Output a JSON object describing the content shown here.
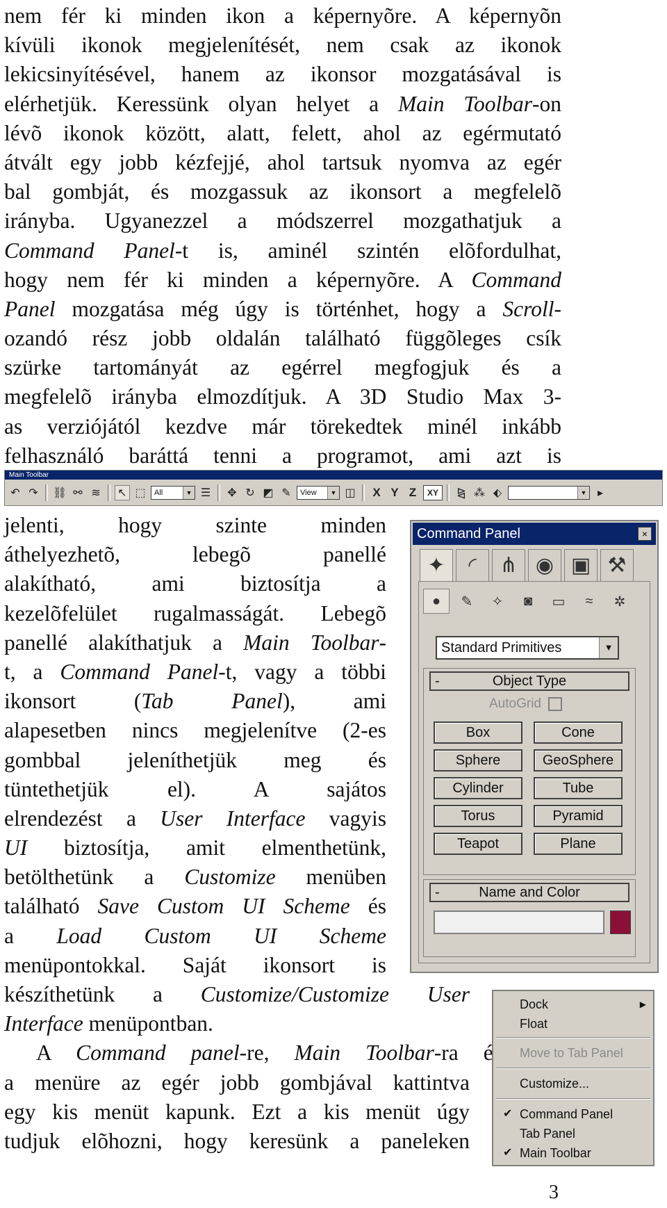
{
  "top_paragraph": [
    "nem fér ki minden ikon a képernyõre. A képernyõn",
    "kívüli ikonok megjelenítését, nem csak az ikonok",
    "lekicsinyítésével, hanem az ikonsor mozgatásával is",
    [
      "elérhetjük. Keressünk olyan helyet a ",
      "Main Toolbar",
      "-on"
    ],
    "lévõ ikonok között, alatt, felett, ahol az egérmutató",
    "átvált egy jobb kézfejjé, ahol tartsuk nyomva az egér",
    "bal gombját, és mozgassuk az ikonsort a megfelelõ",
    "irányba. Ugyanezzel a módszerrel mozgathatjuk a",
    [
      "",
      "Command Panel",
      "-t is, aminél szintén elõfordulhat,"
    ],
    [
      "hogy nem fér ki minden a képernyõre. A ",
      "Command",
      ""
    ],
    [
      "",
      "Panel",
      " mozgatása még úgy is történhet, hogy a ",
      "Scroll",
      "-"
    ],
    "ozandó rész jobb oldalán található függõleges csík",
    "szürke tartományát az egérrel megfogjuk és a",
    "megfelelõ irányba elmozdítjuk. A 3D Studio Max 3-",
    "as verziójától kezdve már törekedtek minél inkább",
    "felhasználó baráttá tenni a programot, ami azt is"
  ],
  "toolbar": {
    "title": "Main Toolbar",
    "selection_filter": "All",
    "reference_coord": "View",
    "axis_x": "X",
    "axis_y": "Y",
    "axis_z": "Z",
    "axis_xy": "XY"
  },
  "side_paragraph": [
    "jelenti, hogy szinte minden",
    "áthelyezhetõ, lebegõ panellé",
    "alakítható, ami biztosítja a",
    "kezelõfelület rugalmasságát. Lebegõ",
    [
      "panellé alakíthatjuk a ",
      "Main Toolbar",
      "-"
    ],
    [
      "t, a ",
      "Command Panel",
      "-t, vagy a többi"
    ],
    [
      "ikonsort (",
      "Tab Panel",
      "), ami"
    ],
    "alapesetben nincs megjelenítve (2-es",
    "gombbal jeleníthetjük meg és",
    "tüntethetjük el). A sajátos",
    [
      "elrendezést a ",
      "User Interface",
      " vagyis"
    ],
    [
      "",
      "UI",
      " biztosítja, amit elmenthetünk,"
    ],
    [
      "betölthetünk a ",
      "Customize",
      " menüben"
    ],
    [
      "található ",
      "Save Custom UI Scheme",
      " és"
    ],
    [
      "a ",
      "Load Custom UI Scheme",
      ""
    ],
    "menüpontokkal. Saját ikonsort is",
    [
      "készíthetünk a ",
      "Customize/Customize User",
      ""
    ],
    [
      "",
      "Interface",
      " menüpontban."
    ],
    [
      "A ",
      "Command panel",
      "-re, ",
      "Main Toolbar",
      "-ra és"
    ],
    "a menüre az egér jobb gombjával kattintva",
    "egy kis menüt kapunk. Ezt a kis menüt úgy",
    "tudjuk elõhozni, hogy keresünk a paneleken"
  ],
  "command_panel": {
    "title": "Command Panel",
    "close": "×",
    "category": "Standard Primitives",
    "rollout_object_type": "Object Type",
    "autogrid": "AutoGrid",
    "objects": [
      "Box",
      "Cone",
      "Sphere",
      "GeoSphere",
      "Cylinder",
      "Tube",
      "Torus",
      "Pyramid",
      "Teapot",
      "Plane"
    ],
    "rollout_name_color": "Name and Color",
    "rollout_minus": "-",
    "color_swatch": "#8b1038"
  },
  "context_menu": {
    "dock": "Dock",
    "float": "Float",
    "move_to_tab_panel": "Move to Tab Panel",
    "customize": "Customize...",
    "command_panel": "Command Panel",
    "tab_panel": "Tab Panel",
    "main_toolbar": "Main Toolbar",
    "checks": {
      "command_panel": true,
      "tab_panel": false,
      "main_toolbar": true
    }
  },
  "page_number": "3"
}
